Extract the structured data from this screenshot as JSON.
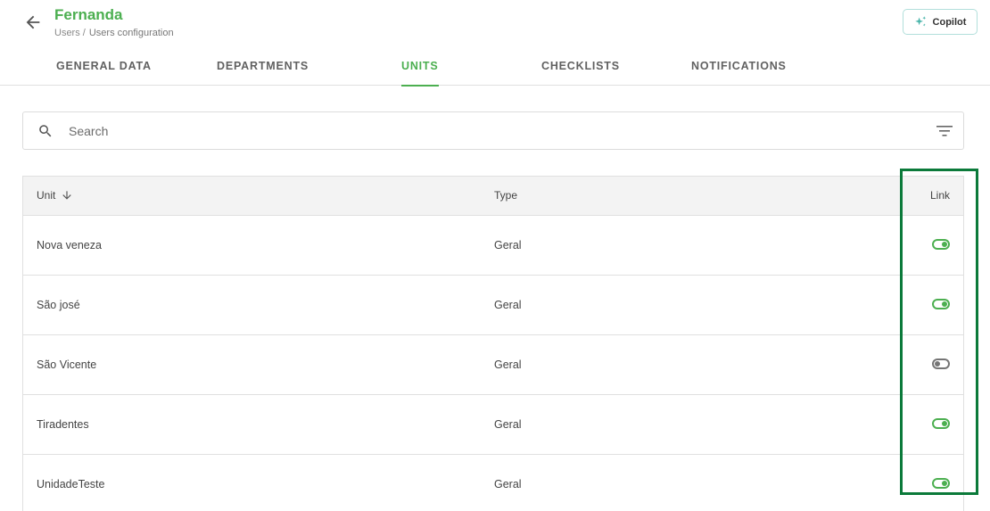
{
  "header": {
    "title": "Fernanda",
    "breadcrumb": [
      {
        "label": "Users /"
      },
      {
        "label": "Users configuration"
      }
    ],
    "copilot_label": "Copilot"
  },
  "tabs": [
    {
      "label": "GENERAL DATA",
      "active": false
    },
    {
      "label": "DEPARTMENTS",
      "active": false
    },
    {
      "label": "UNITS",
      "active": true
    },
    {
      "label": "CHECKLISTS",
      "active": false
    },
    {
      "label": "NOTIFICATIONS",
      "active": false
    }
  ],
  "search": {
    "placeholder": "Search",
    "value": ""
  },
  "table": {
    "columns": {
      "unit": "Unit",
      "type": "Type",
      "link": "Link"
    },
    "sort": {
      "column": "unit",
      "direction": "down"
    },
    "rows": [
      {
        "unit": "Nova veneza",
        "type": "Geral",
        "linked": true
      },
      {
        "unit": "São josé",
        "type": "Geral",
        "linked": true
      },
      {
        "unit": "São Vicente",
        "type": "Geral",
        "linked": false
      },
      {
        "unit": "Tiradentes",
        "type": "Geral",
        "linked": true
      },
      {
        "unit": "UnidadeTeste",
        "type": "Geral",
        "linked": true
      }
    ]
  },
  "colors": {
    "accent": "#4caf50",
    "highlight": "#0b7a3a",
    "toggle_off": "#757575"
  },
  "icons": [
    "arrow-left-icon",
    "sparkle-icon",
    "search-icon",
    "filter-icon",
    "arrow-down-icon",
    "toggle-icon"
  ]
}
